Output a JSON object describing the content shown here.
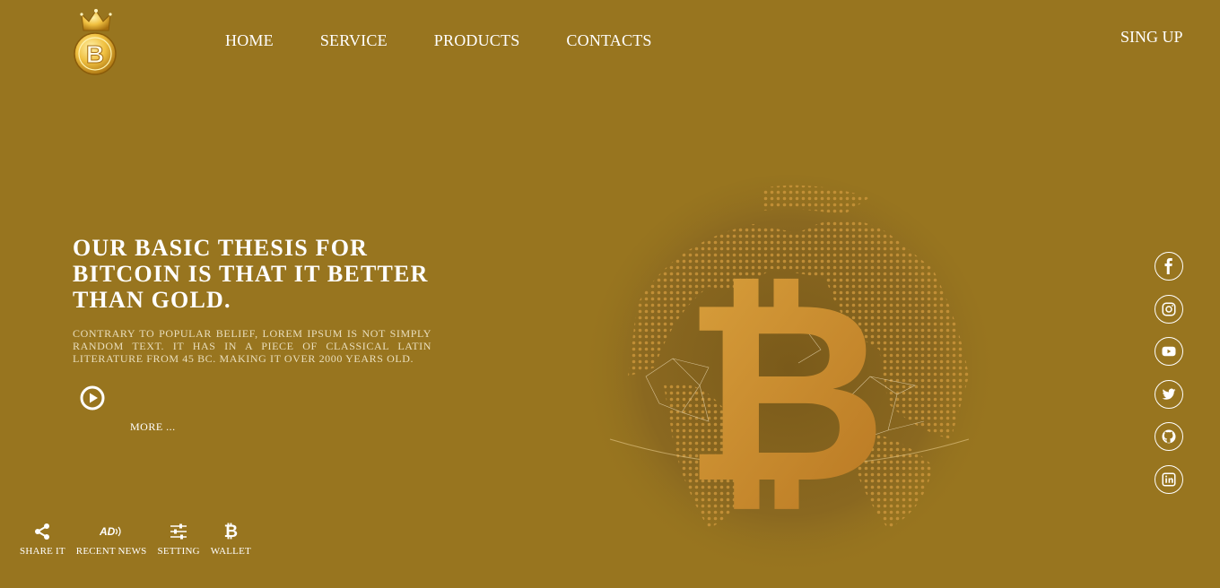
{
  "brand": {
    "logo_letter": "B"
  },
  "nav": {
    "items": [
      {
        "label": "HOME"
      },
      {
        "label": "SERVICE"
      },
      {
        "label": "PRODUCTS"
      },
      {
        "label": "CONTACTS"
      }
    ],
    "signup_label": "SING UP"
  },
  "hero": {
    "title": "OUR BASIC THESIS FOR BITCOIN IS THAT IT BETTER THAN GOLD.",
    "body": "CONTRARY TO POPULAR BELIEF, LOREM IPSUM IS NOT SIMPLY RANDOM TEXT. IT HAS IN A PIECE OF CLASSICAL LATIN LITERATURE FROM 45 BC. MAKING IT OVER 2000 YEARS OLD.",
    "more_label": "MORE ..."
  },
  "social": [
    "facebook-icon",
    "instagram-icon",
    "youtube-icon",
    "twitter-icon",
    "github-icon",
    "linkedin-icon"
  ],
  "toolbar": {
    "share_label": "SHARE IT",
    "news_label": "RECENT NEWS",
    "news_icon_text": "AD",
    "setting_label": "SETTING",
    "wallet_label": "WALLET",
    "wallet_icon_text": "₿"
  },
  "colors": {
    "background": "#98751f",
    "gold": "#d99a2b",
    "text": "#ffffff"
  }
}
